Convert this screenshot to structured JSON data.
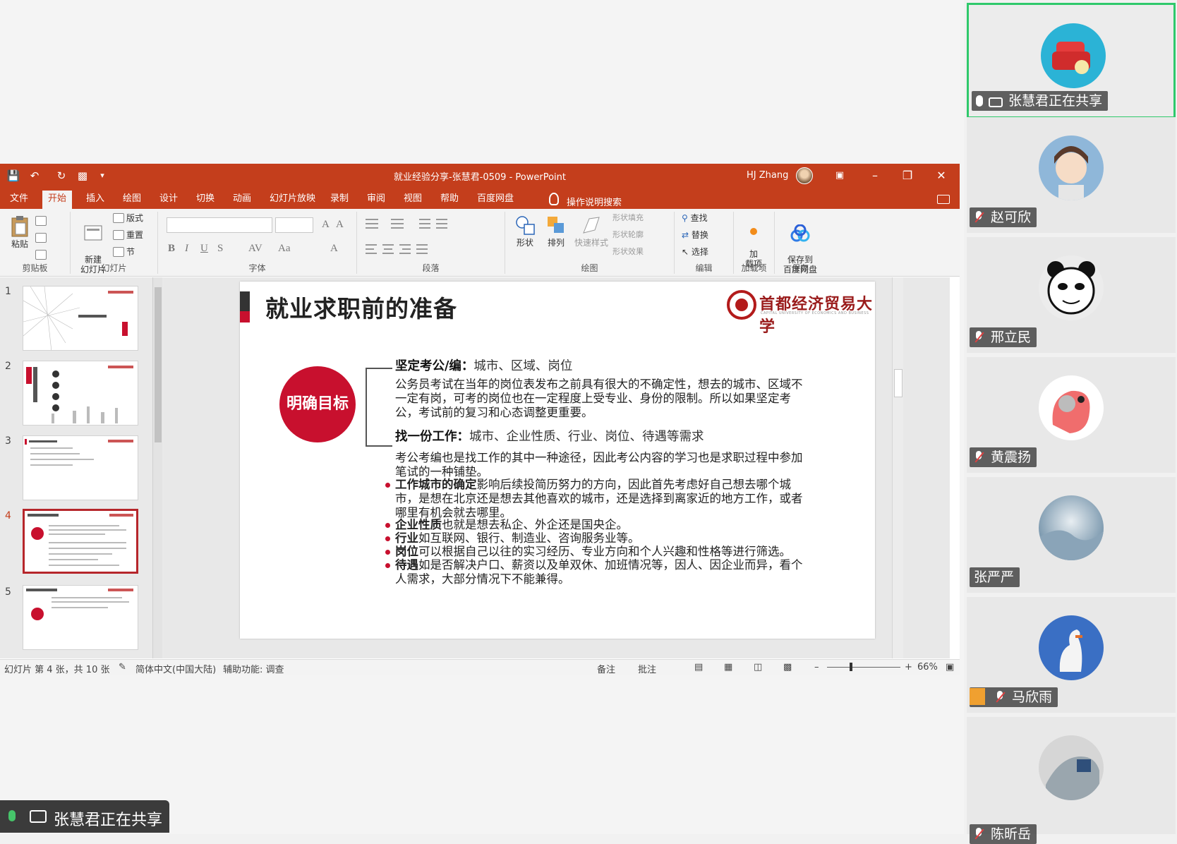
{
  "ppt": {
    "window_title": "就业经验分享-张慧君-0509  -  PowerPoint",
    "user": "HJ Zhang",
    "tabs": [
      "文件",
      "开始",
      "插入",
      "绘图",
      "设计",
      "切换",
      "动画",
      "幻灯片放映",
      "录制",
      "审阅",
      "视图",
      "帮助",
      "百度网盘"
    ],
    "active_tab": "开始",
    "tell_me": "操作说明搜索",
    "ribbon": {
      "paste": "粘贴",
      "new_slide": "新建\n幻灯片",
      "layout": "版式",
      "reset": "重置",
      "section": "节",
      "shapes": "形状",
      "arrange": "排列",
      "quick_styles": "快速样式",
      "shape_fill": "形状填充",
      "shape_outline": "形状轮廓",
      "shape_effects": "形状效果",
      "find": "查找",
      "replace": "替换",
      "select": "选择",
      "addins": "加\n载项",
      "save_baidu": "保存到\n百度网盘",
      "group_clipboard": "剪贴板",
      "group_slides": "幻灯片",
      "group_font": "字体",
      "group_paragraph": "段落",
      "group_drawing": "绘图",
      "group_editing": "编辑",
      "group_addins": "加载项",
      "group_save": "保存"
    },
    "slide_numbers": [
      "1",
      "2",
      "3",
      "4",
      "5"
    ],
    "selected_slide": 4,
    "status": {
      "slide_info": "幻灯片 第 4 张，共 10 张",
      "language": "简体中文(中国大陆)",
      "accessibility": "辅助功能: 调查",
      "notes": "备注",
      "comments": "批注",
      "zoom": "66%"
    },
    "slide": {
      "title": "就业求职前的准备",
      "logo_text": "首都经济贸易大学",
      "logo_en": "CAPITAL UNIVERSITY OF ECONOMICS AND BUSINESS",
      "circle_text": "明确目标",
      "head1_bold": "坚定考公/编：",
      "head1_rest": "城市、区域、岗位",
      "para1": "公务员考试在当年的岗位表发布之前具有很大的不确定性，想去的城市、区域不一定有岗，可考的岗位也在一定程度上受专业、身份的限制。所以如果坚定考公，考试前的复习和心态调整更重要。",
      "head2_bold": "找一份工作：",
      "head2_rest": "城市、企业性质、行业、岗位、待遇等需求",
      "para2": "考公考编也是找工作的其中一种途径，因此考公内容的学习也是求职过程中参加笔试的一种铺垫。",
      "bullets": [
        {
          "bold": "工作城市的确定",
          "rest": "影响后续投简历努力的方向，因此首先考虑好自己想去哪个城市，是想在北京还是想去其他喜欢的城市，还是选择到离家近的地方工作，或者哪里有机会就去哪里。"
        },
        {
          "bold": "企业性质",
          "rest": "也就是想去私企、外企还是国央企。"
        },
        {
          "bold": "行业",
          "rest": "如互联网、银行、制造业、咨询服务业等。"
        },
        {
          "bold": "岗位",
          "rest": "可以根据自己以往的实习经历、专业方向和个人兴趣和性格等进行筛选。"
        },
        {
          "bold": "待遇",
          "rest": "如是否解决户口、薪资以及单双休、加班情况等，因人、因企业而异，看个人需求，大部分情况下不能兼得。"
        }
      ]
    }
  },
  "share_banner": "张慧君正在共享",
  "participants": [
    {
      "name": "张慧君正在共享",
      "active": true
    },
    {
      "name": "赵可欣"
    },
    {
      "name": "邢立民"
    },
    {
      "name": "黄震扬"
    },
    {
      "name": "张严严"
    },
    {
      "name": "马欣雨"
    },
    {
      "name": "陈昕岳"
    }
  ],
  "colors": {
    "ppt_red": "#c43e1c",
    "accent_red": "#c8102e",
    "active_green": "#2fc96b"
  }
}
